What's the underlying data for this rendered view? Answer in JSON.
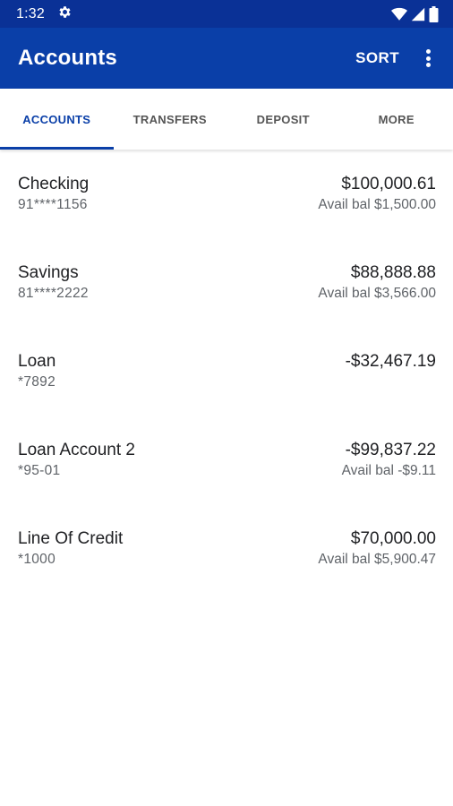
{
  "status_bar": {
    "time": "1:32",
    "icons": [
      "settings-gear-icon",
      "wifi-icon",
      "signal-icon",
      "battery-icon"
    ]
  },
  "app_bar": {
    "title": "Accounts",
    "sort_label": "SORT",
    "overflow_icon": "more-vert-icon"
  },
  "tabs": [
    {
      "label": "ACCOUNTS",
      "active": true
    },
    {
      "label": "TRANSFERS",
      "active": false
    },
    {
      "label": "DEPOSIT",
      "active": false
    },
    {
      "label": "MORE",
      "active": false
    }
  ],
  "accounts": [
    {
      "name": "Checking",
      "number": "91****1156",
      "balance": "$100,000.61",
      "avail": "Avail bal $1,500.00"
    },
    {
      "name": "Savings",
      "number": "81****2222",
      "balance": "$88,888.88",
      "avail": "Avail bal $3,566.00"
    },
    {
      "name": "Loan",
      "number": "*7892",
      "balance": "-$32,467.19",
      "avail": ""
    },
    {
      "name": "Loan Account 2",
      "number": "*95-01",
      "balance": "-$99,837.22",
      "avail": "Avail bal -$9.11"
    },
    {
      "name": "Line Of Credit",
      "number": "*1000",
      "balance": "$70,000.00",
      "avail": "Avail bal $5,900.47"
    }
  ],
  "colors": {
    "status_bar": "#0a3196",
    "primary": "#0a3fa8",
    "secondary_text": "#5f6368"
  }
}
